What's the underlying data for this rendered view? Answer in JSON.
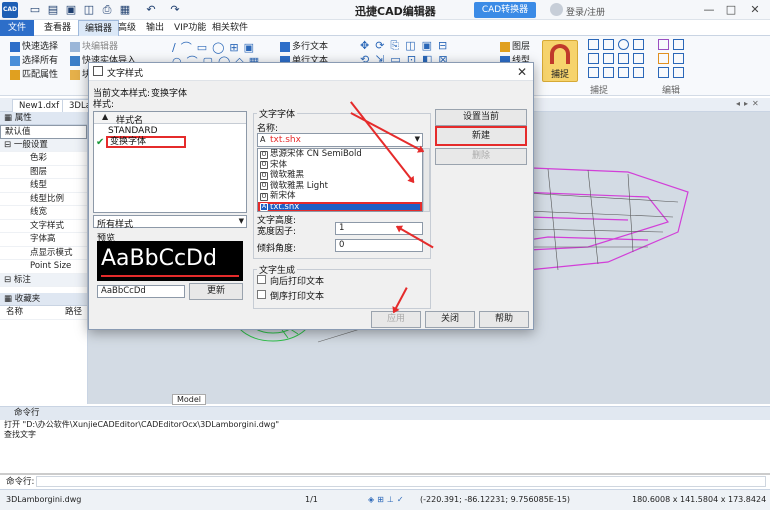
{
  "app": {
    "logo": "CAD",
    "title": "迅捷CAD编辑器",
    "convert_button": "CAD转换器",
    "login": "登录/注册"
  },
  "menu": {
    "tabs": [
      "文件",
      "查看器",
      "编辑器",
      "高级",
      "输出",
      "VIP功能",
      "相关软件"
    ],
    "active": "编辑器"
  },
  "ribbon": {
    "select_group": [
      "快速选择",
      "选择所有",
      "匹配属性"
    ],
    "block_group": [
      "块编辑器",
      "快速实体导入",
      "块"
    ],
    "text_group": [
      "多行文本",
      "单行文本"
    ],
    "layer_group": [
      "图层",
      "线型"
    ],
    "capture_label": "捕捉",
    "capture_group_label": "捕捉",
    "edit_group_label": "编辑"
  },
  "file_tabs": [
    "New1.dxf",
    "3DLa"
  ],
  "properties": {
    "header": "属性",
    "default": "默认值",
    "section": "一般设置",
    "rows": [
      "色彩",
      "图层",
      "线型",
      "线型比例",
      "线宽",
      "文字样式",
      "字体高",
      "点显示模式",
      "Point Size"
    ],
    "section2": "标注",
    "favorites": "收藏夹",
    "name_col": "名称",
    "path_col": "路径"
  },
  "canvas": {
    "model_tab": "Model"
  },
  "command": {
    "header": "命令行",
    "lines": [
      "打开 \"D:\\办公软件\\XunjieCADEditor\\CADEditorOcx\\3DLamborgini.dwg\"",
      "查找文字"
    ],
    "input_label": "命令行:"
  },
  "status": {
    "file": "3DLamborgini.dwg",
    "page": "1/1",
    "coords": "(-220.391; -86.12231; 9.756085E-15)",
    "size": "180.6008 x 141.5804 x 173.8424"
  },
  "dialog": {
    "title": "文字样式",
    "current_label": "当前文本样式:",
    "current_value": "变换字体",
    "styles_label": "样式:",
    "styles_header": "样式名",
    "styles": [
      "STANDARD",
      "变换字体"
    ],
    "filter_value": "所有样式",
    "preview_label": "预览",
    "preview_text": "AaBbCcDd",
    "preview_input": "AaBbCcDd",
    "refresh_button": "更新",
    "font_group": "文字字体",
    "font_name_label": "名称:",
    "font_selected": "txt.shx",
    "font_options": [
      "思源宋体 CN SemiBold",
      "宋体",
      "微软雅黑",
      "微软雅黑 Light",
      "新宋体",
      "txt.shx"
    ],
    "height_label": "文字高度:",
    "width_label": "宽度因子:",
    "width_value": "1",
    "oblique_label": "倾斜角度:",
    "oblique_value": "0",
    "gen_group": "文字生成",
    "backward": "向后打印文本",
    "upside_down": "倒序打印文本",
    "set_current_button": "设置当前",
    "new_button": "新建",
    "delete_button": "删除",
    "apply_button": "应用",
    "close_button": "关闭",
    "help_button": "帮助"
  },
  "colors": {
    "accent": "#2d6ec9",
    "annotation": "#e52b2b",
    "wire": "#d23fd8"
  }
}
